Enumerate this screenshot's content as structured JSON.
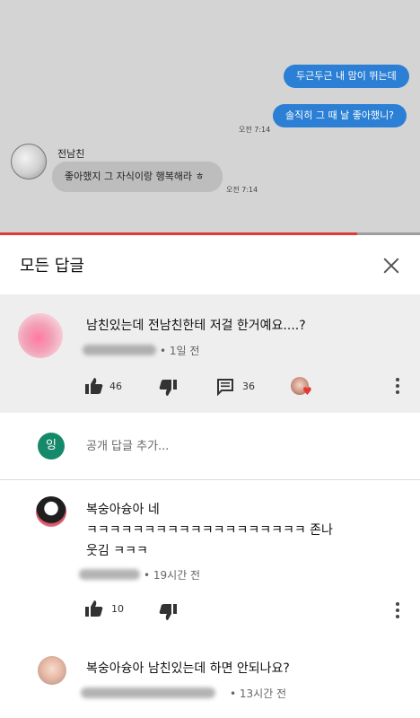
{
  "video": {
    "chat": {
      "right_bubbles": [
        "두근두근 내 맘이 뛰는데",
        "솔직히 그 때 날 좋아했니?"
      ],
      "right_time": "오전 7:14",
      "left_name": "전남친",
      "left_bubble": "좋아했지 그 자식이랑 행복해라 ㅎ",
      "left_time": "오전 7:14"
    },
    "progress": 0.85,
    "progress_color": "#e53935"
  },
  "replies_header": {
    "title": "모든 답글"
  },
  "top_comment": {
    "text": "남친있는데 전남친한테 저걸 한거예요....?",
    "time": "• 1일 전",
    "likes": "46",
    "replies": "36"
  },
  "add_reply": {
    "avatar_letter": "잉",
    "placeholder": "공개 답글 추가..."
  },
  "replies": [
    {
      "text_line1": "복숭아슝아 네",
      "text_line2": "ㅋㅋㅋㅋㅋㅋㅋㅋㅋㅋㅋㅋㅋㅋㅋㅋㅋㅋㅋ 존나",
      "text_line3": "웃김 ㅋㅋㅋ",
      "time": "• 19시간 전",
      "likes": "10"
    },
    {
      "text_line1": "복숭아슝아 남친있는데 하면 안되나요?",
      "time": "• 13시간 전"
    }
  ],
  "icons": [
    "thumbs-up-icon",
    "thumbs-down-icon",
    "reply-comment-icon",
    "creator-heart-icon",
    "more-vert-icon",
    "close-icon"
  ],
  "colors": {
    "accent_red": "#e53935",
    "chat_blue": "#2b7fd4",
    "avatar_green": "#16896a"
  }
}
